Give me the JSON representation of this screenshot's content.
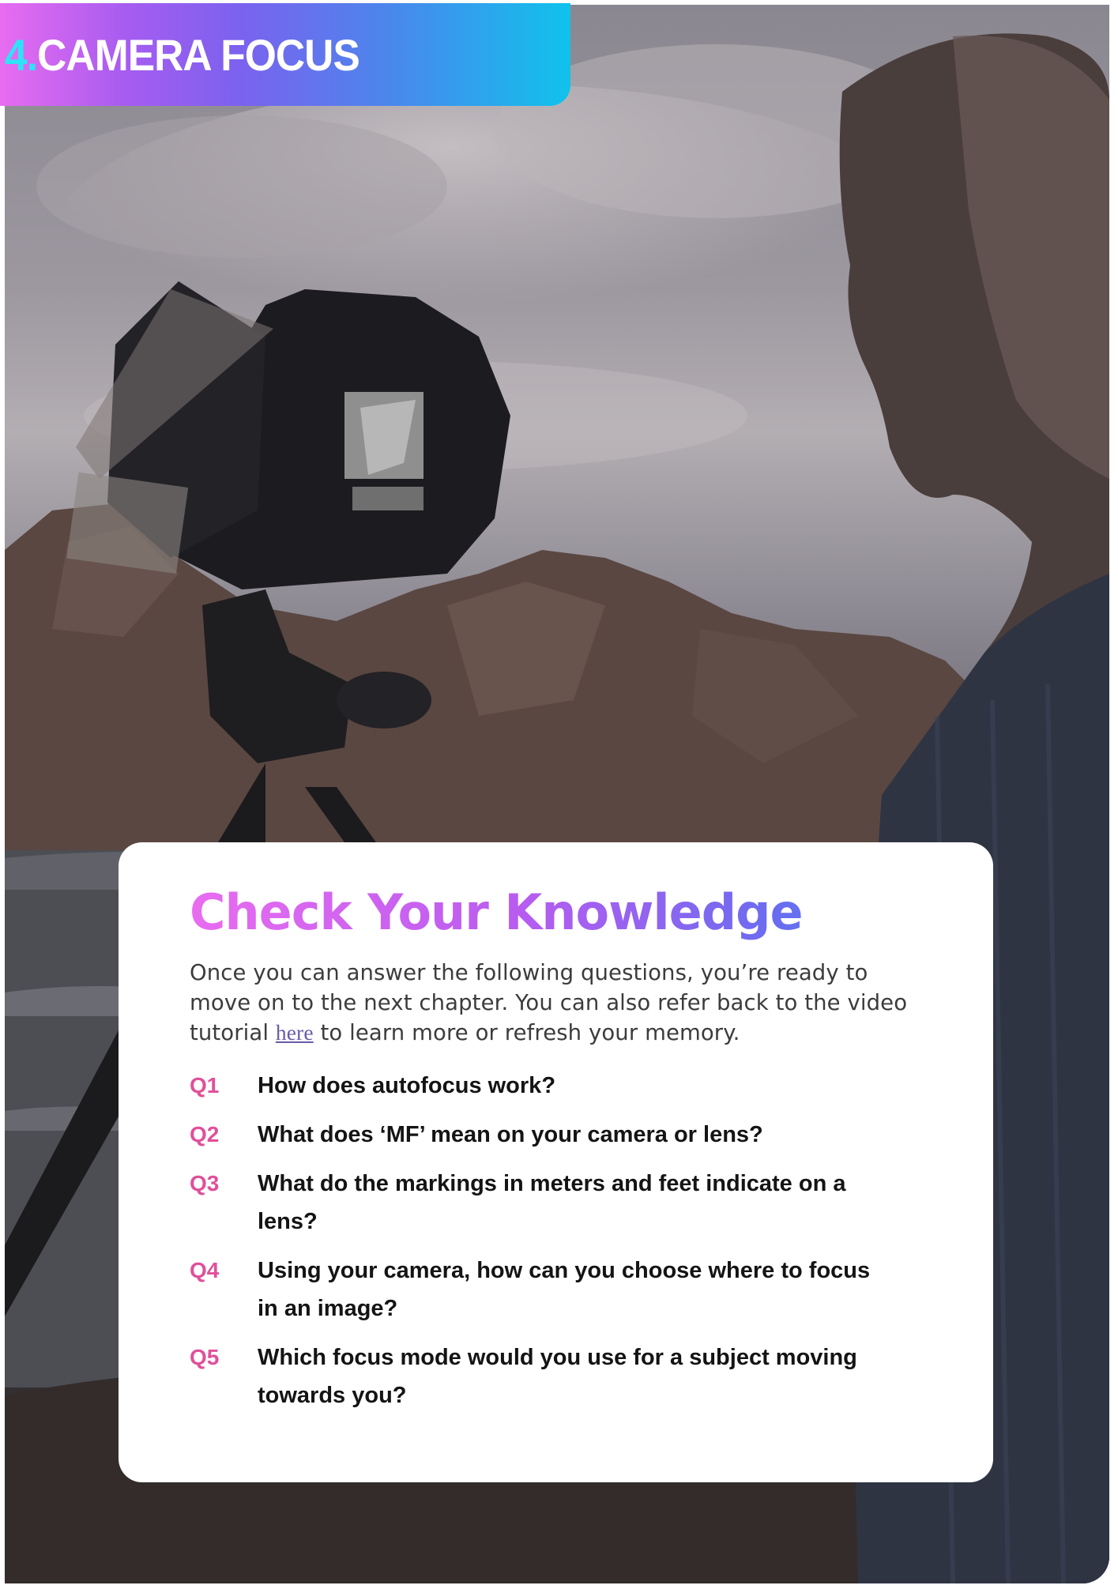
{
  "banner": {
    "number": "4.",
    "title": "CAMERA FOCUS"
  },
  "knowledge": {
    "title": "Check Your Knowledge",
    "intro_before_link": "Once you can answer the following questions, you’re ready to move on to the next chapter. You can also refer back to the video tutorial ",
    "link_label": "here",
    "intro_after_link": " to learn more or refresh your memory.",
    "questions": [
      {
        "number": "Q1",
        "text": "How does autofocus work?"
      },
      {
        "number": "Q2",
        "text": "What does ‘MF’ mean on your camera or lens?"
      },
      {
        "number": "Q3",
        "text": "What do the markings in meters and feet indicate on a lens?"
      },
      {
        "number": "Q4",
        "text": "Using your camera, how can you choose where to focus in an image?"
      },
      {
        "number": "Q5",
        "text": "Which focus mode would you use for a subject moving towards you?"
      }
    ]
  },
  "colors": {
    "accent_pink": "#e0509a",
    "banner_start": "#e86cf0",
    "banner_end": "#10c2ec",
    "banner_number": "#2fe3f7"
  }
}
